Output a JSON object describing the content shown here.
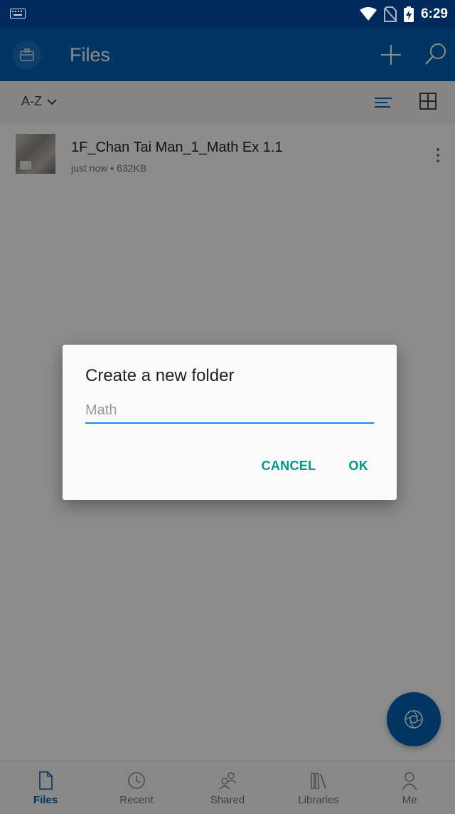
{
  "status_bar": {
    "time": "6:29"
  },
  "app_bar": {
    "title": "Files"
  },
  "toolbar": {
    "sort_label": "A-Z"
  },
  "files": [
    {
      "name": "1F_Chan Tai Man_1_Math Ex 1.1",
      "meta": "just now • 632KB"
    }
  ],
  "bottom_nav": {
    "items": [
      {
        "label": "Files",
        "icon": "file-icon",
        "active": true
      },
      {
        "label": "Recent",
        "icon": "clock-icon",
        "active": false
      },
      {
        "label": "Shared",
        "icon": "people-icon",
        "active": false
      },
      {
        "label": "Libraries",
        "icon": "libraries-icon",
        "active": false
      },
      {
        "label": "Me",
        "icon": "person-icon",
        "active": false
      }
    ]
  },
  "dialog": {
    "title": "Create a new folder",
    "input_placeholder": "Math",
    "input_value": "",
    "cancel_label": "CANCEL",
    "ok_label": "OK"
  },
  "colors": {
    "brand_blue": "#0063b1",
    "status_bar": "#002a5c",
    "dialog_accent": "#009688",
    "input_underline": "#1e88e5"
  }
}
